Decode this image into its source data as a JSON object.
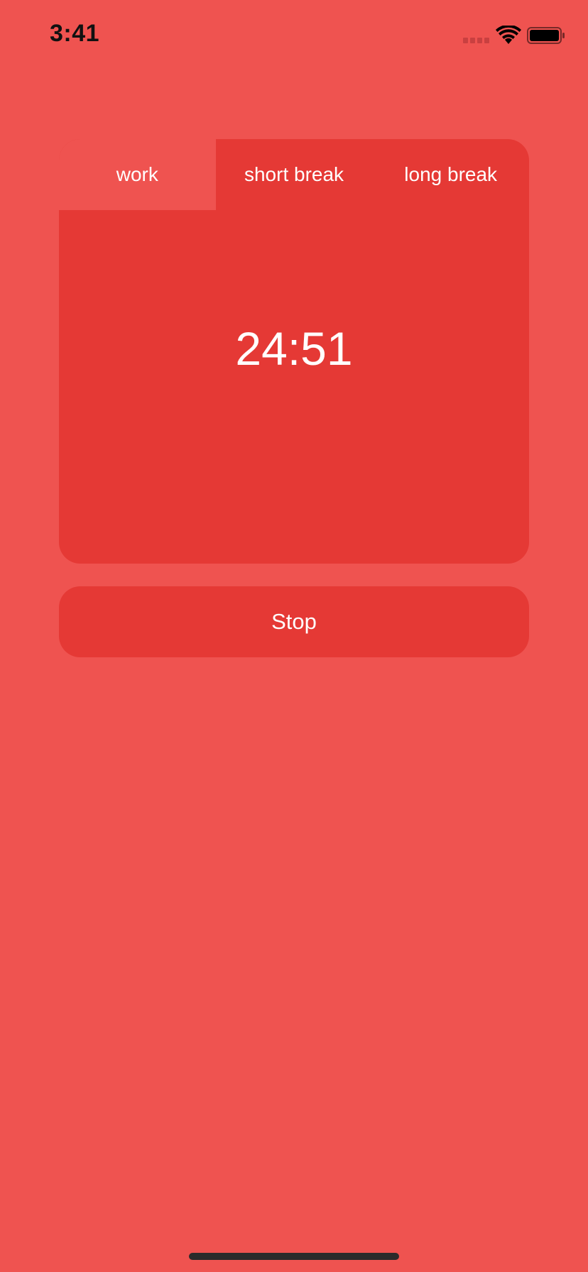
{
  "status_bar": {
    "time": "3:41",
    "icons": [
      "cellular-signal-icon",
      "wifi-icon",
      "battery-icon"
    ]
  },
  "timer": {
    "tabs": [
      {
        "label": "work",
        "active": true
      },
      {
        "label": "short break",
        "active": false
      },
      {
        "label": "long break",
        "active": false
      }
    ],
    "time_remaining": "24:51"
  },
  "actions": {
    "stop_label": "Stop"
  },
  "colors": {
    "background": "#ef5350",
    "card": "#e53935",
    "active_tab": "#ef5350",
    "text": "#ffffff"
  }
}
